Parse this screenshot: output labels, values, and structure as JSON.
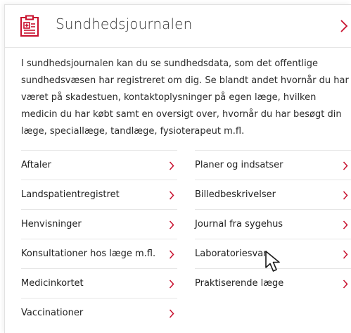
{
  "header": {
    "title": "Sundhedsjournalen",
    "icon": "medical-journal-icon",
    "chevron_icon": "chevron-right-icon"
  },
  "intro": "I sundhedsjournalen kan du se sundhedsdata, som det offentlige sundhedsvæsen har registreret om dig. Se blandt andet hvornår du har været på skadestuen, kontaktoplysninger på egen læge, hvilken medicin du har købt samt en oversigt over, hvornår du har besøgt din læge, speciallæge, tandlæge, fysioterapeut m.fl.",
  "links_left": [
    {
      "label": "Aftaler"
    },
    {
      "label": "Landspatientregistret"
    },
    {
      "label": "Henvisninger"
    },
    {
      "label": "Konsultationer hos læge m.fl."
    },
    {
      "label": "Medicinkortet"
    },
    {
      "label": "Vaccinationer"
    }
  ],
  "links_right": [
    {
      "label": "Planer og indsatser"
    },
    {
      "label": "Billedbeskrivelser"
    },
    {
      "label": "Journal fra sygehus"
    },
    {
      "label": "Laboratoriesvar"
    },
    {
      "label": "Praktiserende læge"
    }
  ],
  "colors": {
    "accent": "#c8102e",
    "text": "#1f1f1f",
    "divider": "#e6e6e6"
  },
  "cursor": "mouse-pointer-icon"
}
